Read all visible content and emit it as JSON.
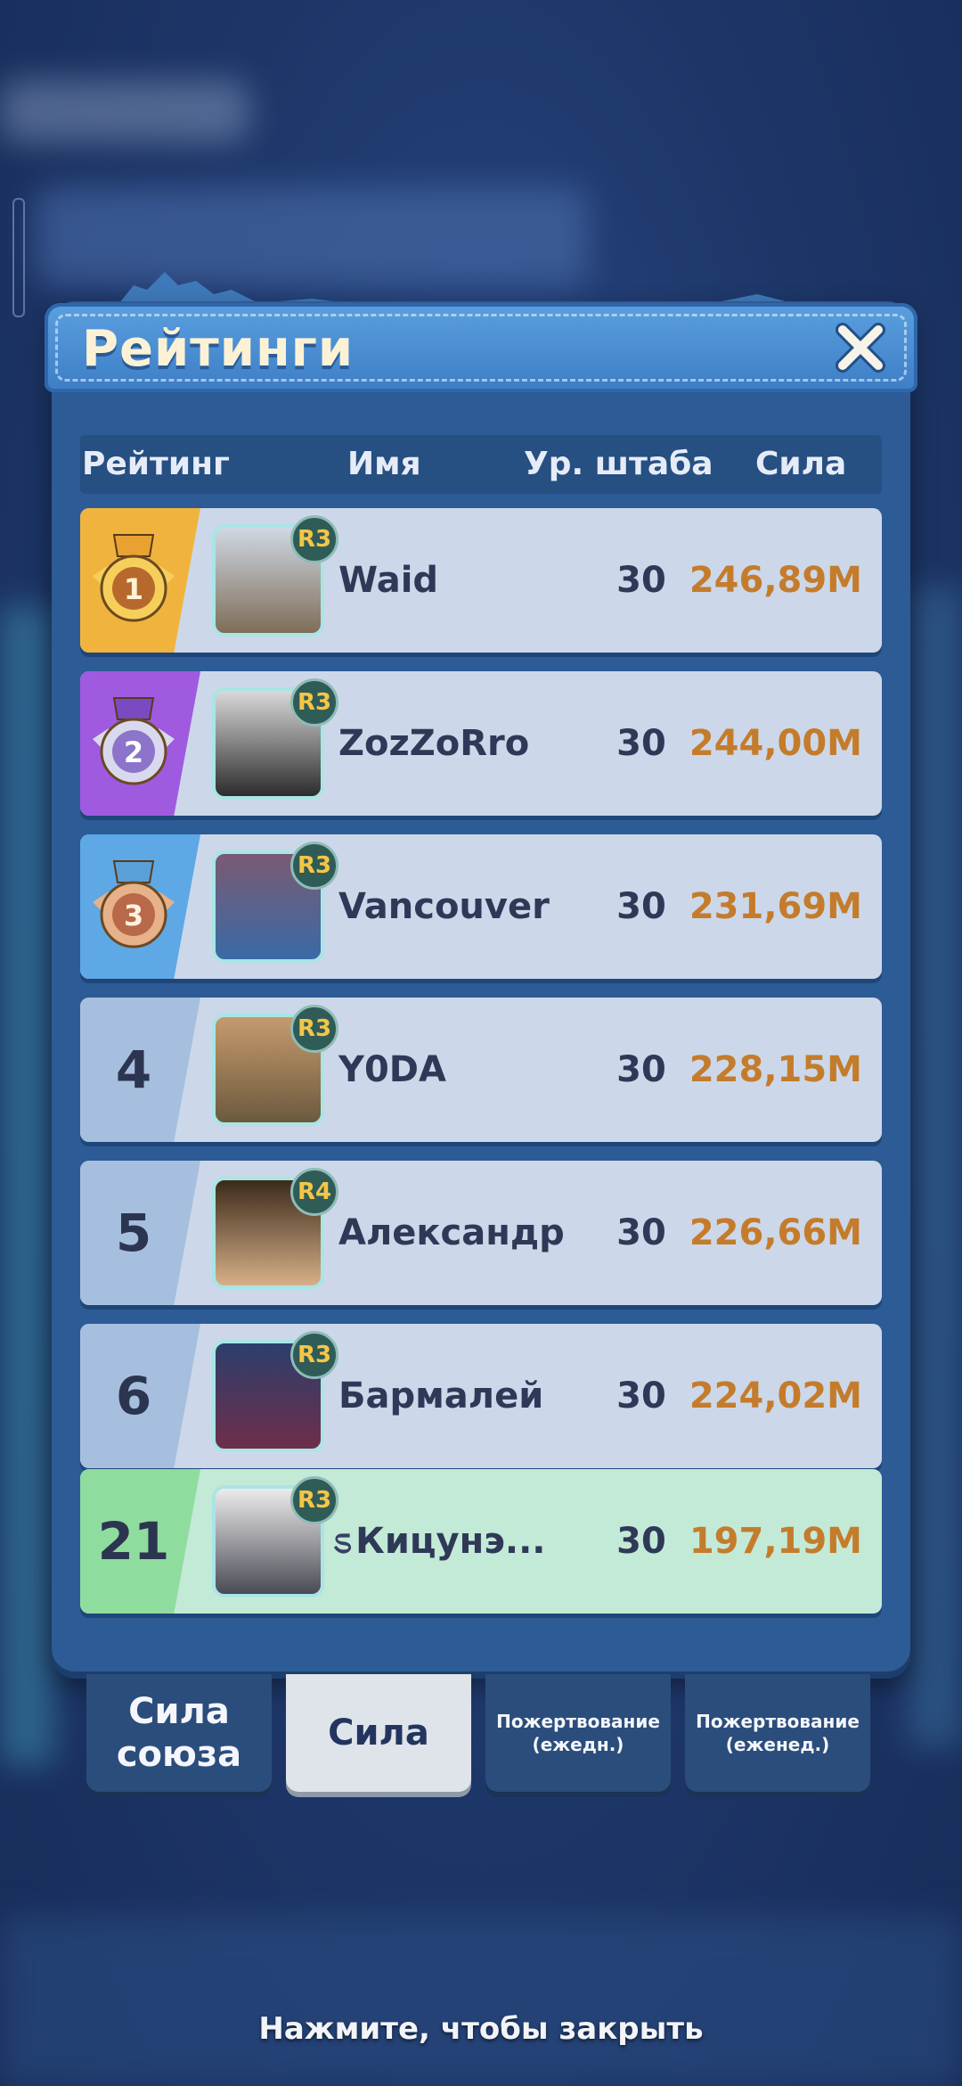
{
  "header": {
    "title": "Рейтинги"
  },
  "columns": {
    "rank": "Рейтинг",
    "name": "Имя",
    "hq_level": "Ур. штаба",
    "power": "Сила"
  },
  "rows": [
    {
      "rank": "1",
      "rank_style": "gold",
      "name": "Waid",
      "badge": "R3",
      "level": "30",
      "power": "246,89M",
      "avatar": "ship-avatar"
    },
    {
      "rank": "2",
      "rank_style": "silver",
      "name": "ZozZoRro",
      "badge": "R3",
      "level": "30",
      "power": "244,00M",
      "avatar": "zorro-avatar"
    },
    {
      "rank": "3",
      "rank_style": "bronze",
      "name": "Vancouver",
      "badge": "R3",
      "level": "30",
      "power": "231,69M",
      "avatar": "girl-avatar"
    },
    {
      "rank": "4",
      "rank_style": "plain",
      "name": "Y0DA",
      "badge": "R3",
      "level": "30",
      "power": "228,15M",
      "avatar": "yoda-avatar"
    },
    {
      "rank": "5",
      "rank_style": "plain",
      "name": "Александр",
      "badge": "R4",
      "level": "30",
      "power": "226,66M",
      "avatar": "man-avatar"
    },
    {
      "rank": "6",
      "rank_style": "plain",
      "name": "Бармалей",
      "badge": "R3",
      "level": "30",
      "power": "224,02M",
      "avatar": "warrior-avatar"
    }
  ],
  "my_row": {
    "rank": "21",
    "name": "Кицунэ...",
    "name_prefix": "ಽ",
    "badge": "R3",
    "level": "30",
    "power": "197,19M",
    "avatar": "anime-avatar"
  },
  "tabs": [
    {
      "label": "Сила союза",
      "active": false
    },
    {
      "label": "Сила",
      "active": true
    },
    {
      "label": "Пожертвование (ежедн.)",
      "active": false
    },
    {
      "label": "Пожертвование (еженед.)",
      "active": false
    }
  ],
  "footer": {
    "hint": "Нажмите, чтобы закрыть"
  },
  "colors": {
    "power": "#c47c2c",
    "gold": "#f0b43e",
    "silver": "#9f5ae0",
    "bronze": "#5ea8e6",
    "me_row": "#c3ead7"
  }
}
